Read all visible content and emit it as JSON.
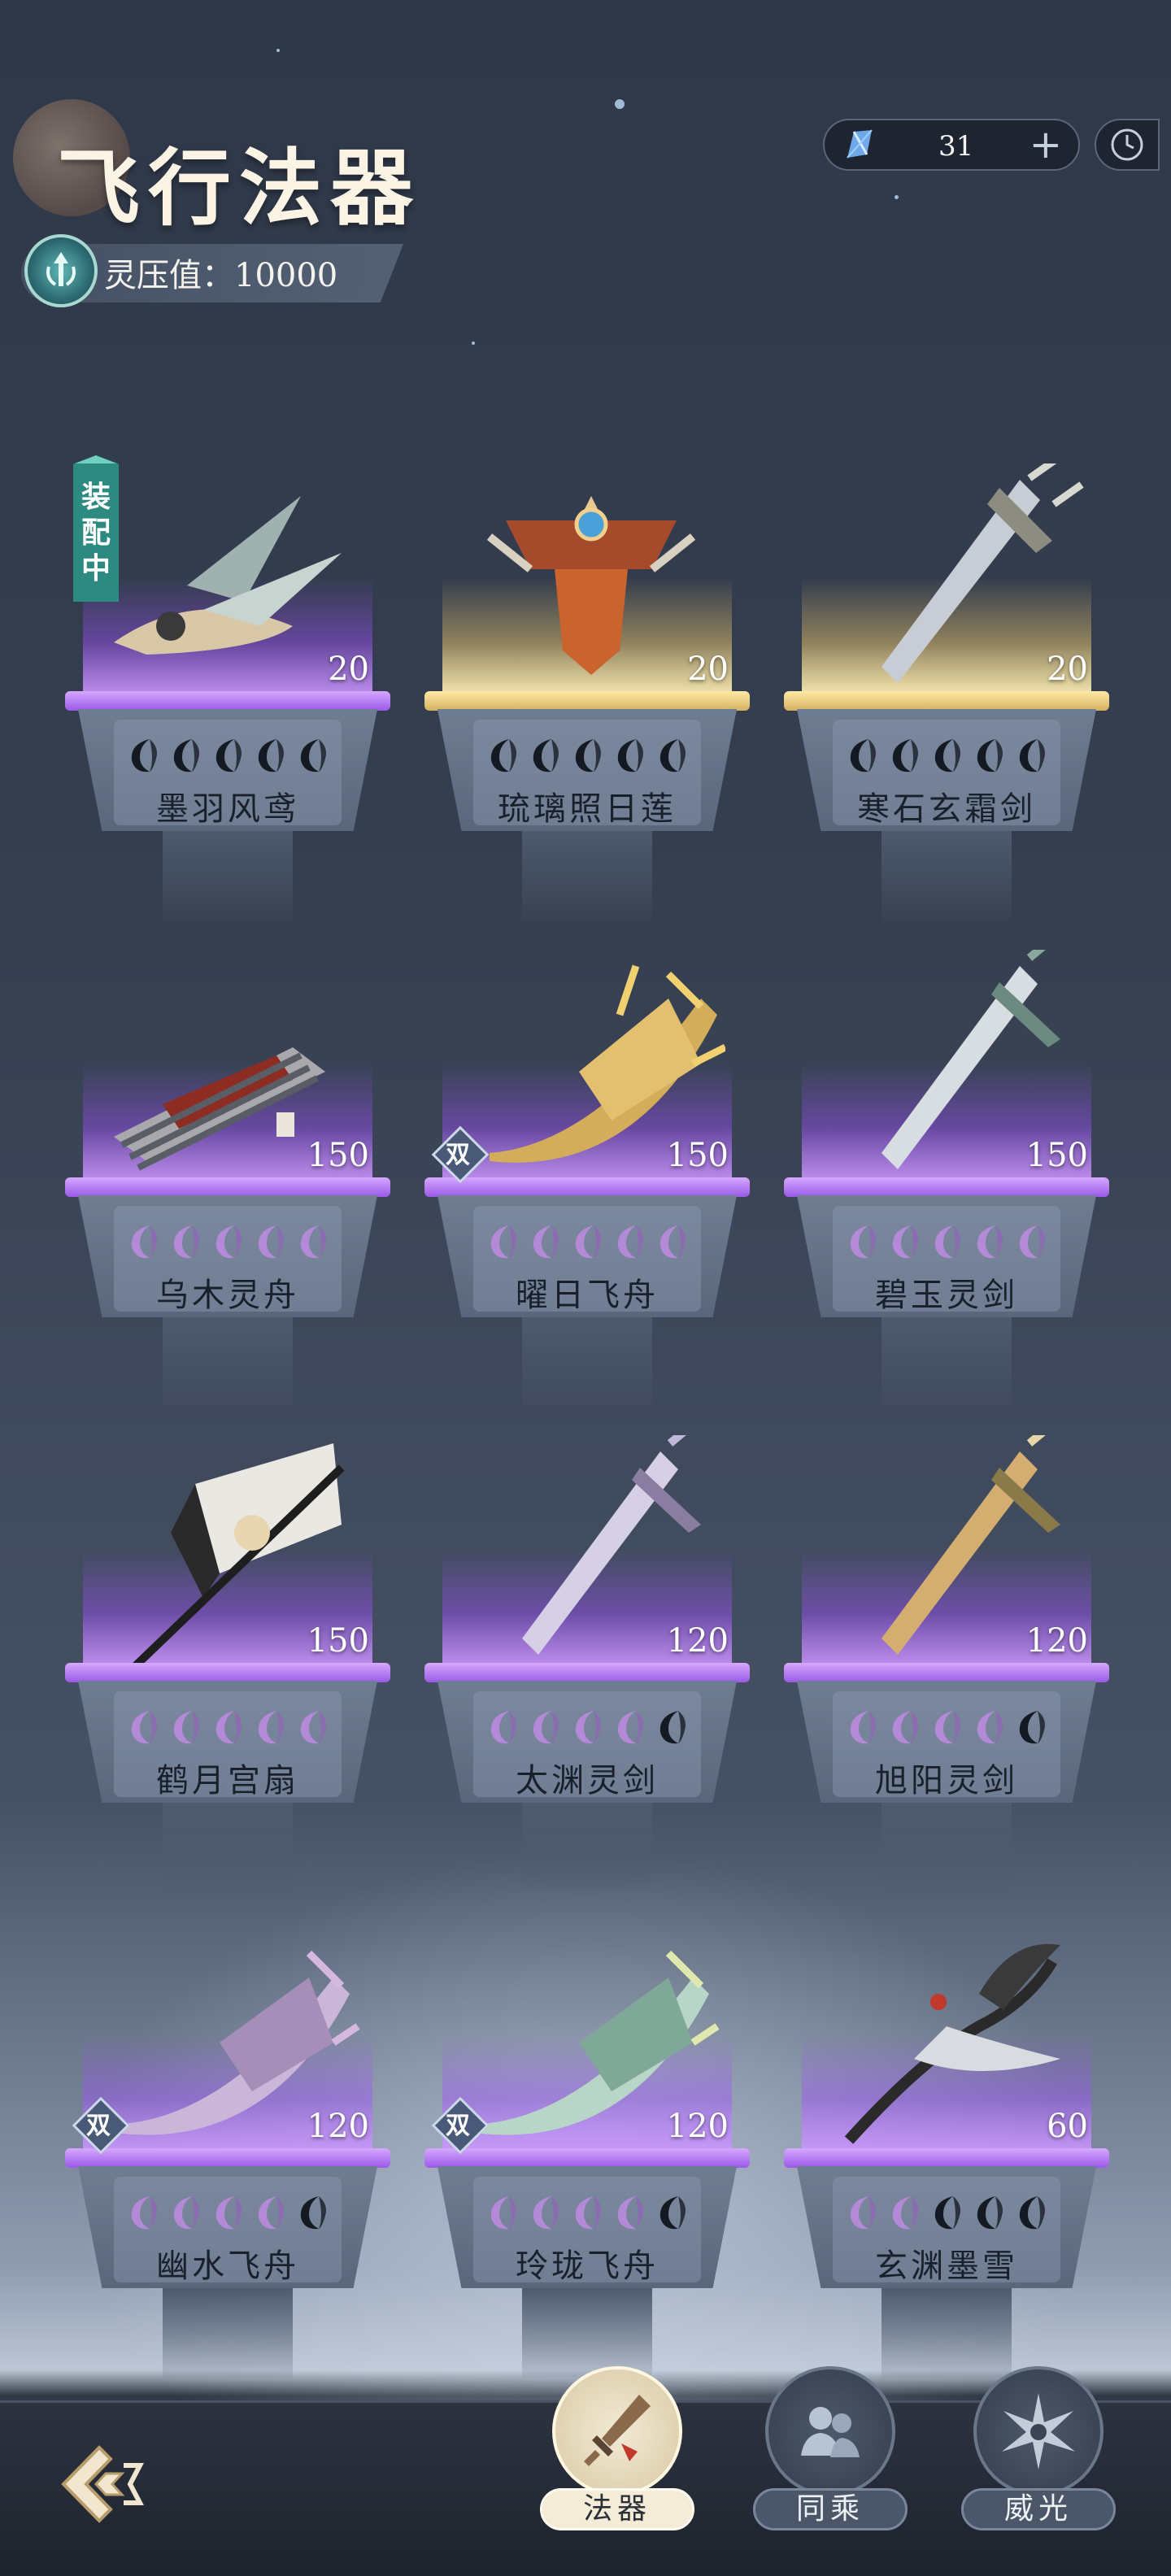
{
  "header": {
    "title": "飞行法器",
    "power_label": "灵压值：",
    "power_value": "10000",
    "currency_value": "31",
    "currency_plus": "+"
  },
  "items": [
    {
      "name": "墨羽风鸢",
      "level": "20",
      "rarity": "purple",
      "stars": [
        "dark",
        "dark",
        "dark",
        "dark",
        "dark"
      ],
      "equipped": true,
      "dual": false
    },
    {
      "name": "琉璃照日莲",
      "level": "20",
      "rarity": "gold",
      "stars": [
        "dark",
        "dark",
        "dark",
        "dark",
        "dark"
      ],
      "equipped": false,
      "dual": false
    },
    {
      "name": "寒石玄霜剑",
      "level": "20",
      "rarity": "gold",
      "stars": [
        "dark",
        "dark",
        "dark",
        "dark",
        "dark"
      ],
      "equipped": false,
      "dual": false
    },
    {
      "name": "乌木灵舟",
      "level": "150",
      "rarity": "purple",
      "stars": [
        "lit",
        "lit",
        "lit",
        "lit",
        "lit"
      ],
      "equipped": false,
      "dual": false
    },
    {
      "name": "曜日飞舟",
      "level": "150",
      "rarity": "purple",
      "stars": [
        "lit",
        "lit",
        "lit",
        "lit",
        "lit"
      ],
      "equipped": false,
      "dual": true
    },
    {
      "name": "碧玉灵剑",
      "level": "150",
      "rarity": "purple",
      "stars": [
        "lit",
        "lit",
        "lit",
        "lit",
        "lit"
      ],
      "equipped": false,
      "dual": false
    },
    {
      "name": "鹤月宫扇",
      "level": "150",
      "rarity": "purple",
      "stars": [
        "lit",
        "lit",
        "lit",
        "lit",
        "lit"
      ],
      "equipped": false,
      "dual": false
    },
    {
      "name": "太渊灵剑",
      "level": "120",
      "rarity": "purple",
      "stars": [
        "lit",
        "lit",
        "lit",
        "lit",
        "dark"
      ],
      "equipped": false,
      "dual": false
    },
    {
      "name": "旭阳灵剑",
      "level": "120",
      "rarity": "purple",
      "stars": [
        "lit",
        "lit",
        "lit",
        "lit",
        "dark"
      ],
      "equipped": false,
      "dual": false
    },
    {
      "name": "幽水飞舟",
      "level": "120",
      "rarity": "purple",
      "stars": [
        "lit",
        "lit",
        "lit",
        "lit",
        "dark"
      ],
      "equipped": false,
      "dual": true
    },
    {
      "name": "玲珑飞舟",
      "level": "120",
      "rarity": "purple",
      "stars": [
        "lit",
        "lit",
        "lit",
        "lit",
        "dark"
      ],
      "equipped": false,
      "dual": true
    },
    {
      "name": "玄渊墨雪",
      "level": "60",
      "rarity": "purple",
      "stars": [
        "lit",
        "lit",
        "dark",
        "dark",
        "dark"
      ],
      "equipped": false,
      "dual": false
    }
  ],
  "equipped_badge_chars": [
    "装",
    "配",
    "中"
  ],
  "dual_badge_label": "双",
  "nav": {
    "tabs": [
      {
        "label": "法器",
        "icon": "sword-icon",
        "active": true
      },
      {
        "label": "同乘",
        "icon": "companions-icon",
        "active": false
      },
      {
        "label": "威光",
        "icon": "burst-icon",
        "active": false
      }
    ],
    "back_icon": "back-arrow-icon"
  },
  "colors": {
    "purple_glow": "#b070ff",
    "gold_glow": "#ffd98a",
    "lit_star": "#b48ad8",
    "dark_star": "#141a22",
    "equipped_badge": "#2d8a80"
  }
}
